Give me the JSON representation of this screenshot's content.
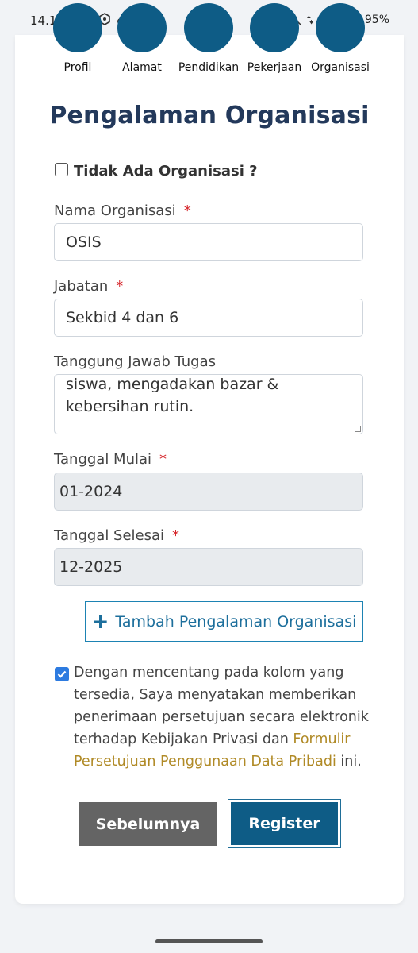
{
  "status_bar": {
    "time": "14.13",
    "battery": "95%",
    "left_icons": [
      "whatsapp-icon",
      "shopee-icon",
      "hexagon-app-icon",
      "tiktok-icon",
      "dot-icon"
    ],
    "right_icons": [
      "mute-icon",
      "data-arrows-icon",
      "wifi-icon",
      "signal-icon",
      "battery-icon"
    ]
  },
  "steps": [
    {
      "label": "Profil"
    },
    {
      "label": "Alamat"
    },
    {
      "label": "Pendidikan"
    },
    {
      "label": "Pekerjaan"
    },
    {
      "label": "Organisasi"
    }
  ],
  "title": "Pengalaman Organisasi",
  "no_org": {
    "label": "Tidak Ada Organisasi ?",
    "checked": false
  },
  "fields": {
    "nama_organisasi": {
      "label": "Nama Organisasi",
      "required": "*",
      "value": "OSIS"
    },
    "jabatan": {
      "label": "Jabatan",
      "required": "*",
      "value": "Sekbid 4 dan 6"
    },
    "tanggung_jawab": {
      "label": "Tanggung Jawab Tugas",
      "value": "siswa, mengadakan bazar & kebersihan rutin."
    },
    "tanggal_mulai": {
      "label": "Tanggal Mulai",
      "required": "*",
      "value": "01-2024"
    },
    "tanggal_selesai": {
      "label": "Tanggal Selesai",
      "required": "*",
      "value": "12-2025"
    }
  },
  "add_button": {
    "label": "Tambah Pengalaman Organisasi"
  },
  "consent": {
    "checked": true,
    "text_before": "Dengan mencentang pada kolom yang tersedia, Saya menyatakan memberikan penerimaan persetujuan secara elektronik terhadap Kebijakan Privasi dan ",
    "link": "Formulir Persetujuan Penggunaan Data Pribadi",
    "text_after": " ini."
  },
  "buttons": {
    "prev": "Sebelumnya",
    "register": "Register"
  },
  "colors": {
    "primary": "#0e5c86",
    "title": "#23395b",
    "link": "#b08a26",
    "required": "#d6262b",
    "checkbox": "#2d7be0"
  }
}
